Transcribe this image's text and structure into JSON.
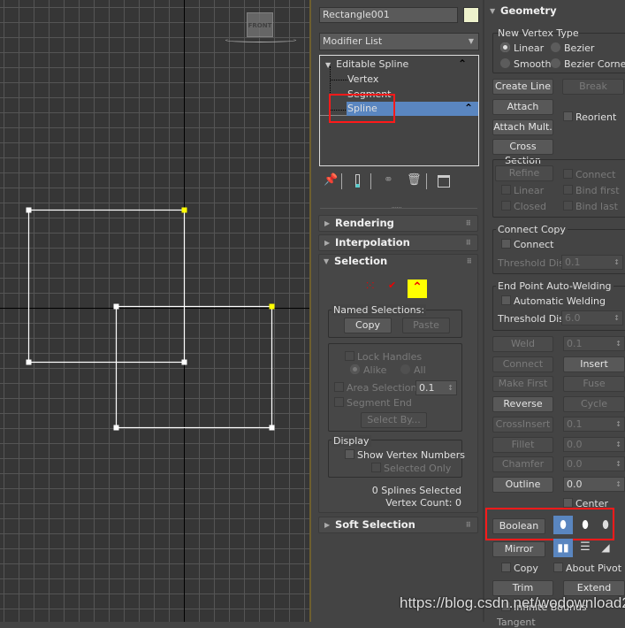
{
  "viewport": {
    "label": "FRONT",
    "grid_color": "#555555",
    "axis_color": "#000000",
    "spline_color": "#ffffff",
    "selected_vertex_color": "#ffff00"
  },
  "object": {
    "name": "Rectangle001",
    "color": "#eef2cc"
  },
  "modifier_list": {
    "label": "Modifier List"
  },
  "stack": {
    "items": [
      {
        "label": "Editable Spline",
        "level": 0
      },
      {
        "label": "Vertex",
        "level": 1
      },
      {
        "label": "Segment",
        "level": 1
      },
      {
        "label": "Spline",
        "level": 1,
        "selected": true
      }
    ],
    "selected_color": "#5a86c0"
  },
  "stack_tools": [
    "pin-stack-icon",
    "show-end-result-icon",
    "make-unique-icon",
    "remove-modifier-icon",
    "configure-modifier-sets-icon"
  ],
  "rollouts": {
    "rendering": "Rendering",
    "interpolation": "Interpolation",
    "selection": "Selection",
    "soft_selection": "Soft Selection",
    "geometry": "Geometry"
  },
  "selection": {
    "level_icons": [
      "vertex-level-icon",
      "segment-level-icon",
      "spline-level-icon"
    ],
    "named_selections": "Named Selections:",
    "copy": "Copy",
    "paste": "Paste",
    "lock_handles": "Lock Handles",
    "alike": "Alike",
    "all": "All",
    "area_selection": "Area Selection:",
    "area_value": "0.1",
    "segment_end": "Segment End",
    "select_by": "Select By...",
    "display": "Display",
    "show_vertex_numbers": "Show Vertex Numbers",
    "selected_only": "Selected Only",
    "status1": "0 Splines Selected",
    "status2": "Vertex Count: 0"
  },
  "geometry": {
    "new_vertex_type": "New Vertex Type",
    "linear": "Linear",
    "bezier": "Bezier",
    "smooth": "Smooth",
    "bezier_corner": "Bezier Corner",
    "create_line": "Create Line",
    "break": "Break",
    "attach": "Attach",
    "reorient": "Reorient",
    "attach_mult": "Attach Mult.",
    "cross_section": "Cross Section",
    "refine": "Refine",
    "connect": "Connect",
    "r_linear": "Linear",
    "bind_first": "Bind first",
    "closed": "Closed",
    "bind_last": "Bind last",
    "connect_copy": "Connect Copy",
    "cc_connect": "Connect",
    "threshold_dist": "Threshold Dist",
    "cc_threshold": "0.1",
    "endpoint_welding": "End Point Auto-Welding",
    "automatic_welding": "Automatic Welding",
    "ep_threshold": "6.0",
    "weld": "Weld",
    "weld_value": "0.1",
    "connect_btn": "Connect",
    "insert": "Insert",
    "make_first": "Make First",
    "fuse": "Fuse",
    "reverse": "Reverse",
    "cycle": "Cycle",
    "crossinsert": "CrossInsert",
    "crossinsert_value": "0.1",
    "fillet": "Fillet",
    "fillet_value": "0.0",
    "chamfer": "Chamfer",
    "chamfer_value": "0.0",
    "outline": "Outline",
    "outline_value": "0.0",
    "center": "Center",
    "boolean": "Boolean",
    "boolean_icons": [
      "union-icon",
      "subtraction-icon",
      "intersection-icon"
    ],
    "mirror": "Mirror",
    "mirror_icons": [
      "mirror-horizontal-icon",
      "mirror-vertical-icon",
      "mirror-both-icon"
    ],
    "copy": "Copy",
    "about_pivot": "About Pivot",
    "trim": "Trim",
    "extend": "Extend",
    "infinite_bounds": "Infinite Bounds",
    "tangent": "Tangent"
  },
  "watermark": "https://blog.csdn.net/wodownload2"
}
